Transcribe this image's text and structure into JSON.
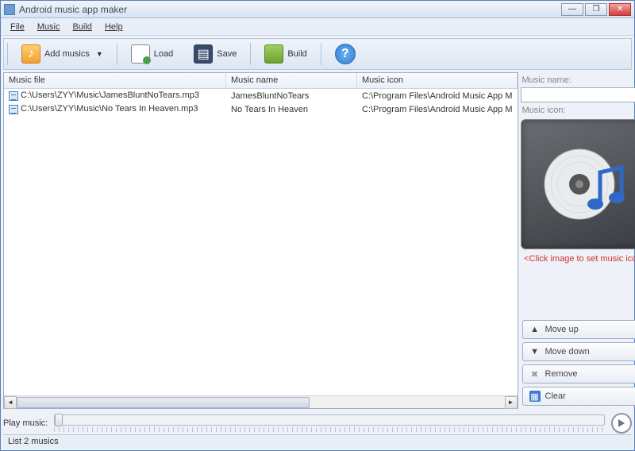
{
  "window": {
    "title": "Android music app maker"
  },
  "menu": {
    "file": "File",
    "music": "Music",
    "build": "Build",
    "help": "Help"
  },
  "toolbar": {
    "add_musics": "Add musics",
    "load": "Load",
    "save": "Save",
    "build": "Build"
  },
  "table": {
    "headers": {
      "file": "Music file",
      "name": "Music name",
      "icon": "Music icon"
    },
    "rows": [
      {
        "file": "C:\\Users\\ZYY\\Music\\JamesBluntNoTears.mp3",
        "name": "JamesBluntNoTears",
        "icon": "C:\\Program Files\\Android Music App M"
      },
      {
        "file": "C:\\Users\\ZYY\\Music\\No Tears In Heaven.mp3",
        "name": "No Tears In Heaven",
        "icon": "C:\\Program Files\\Android Music App M"
      }
    ]
  },
  "right": {
    "music_name_label": "Music name:",
    "music_name_value": "",
    "music_icon_label": "Music icon:",
    "click_hint": "<Click image to set music icon>",
    "move_up": "Move up",
    "move_down": "Move down",
    "remove": "Remove",
    "clear": "Clear"
  },
  "player": {
    "label": "Play music:"
  },
  "status": {
    "text": "List 2 musics"
  }
}
